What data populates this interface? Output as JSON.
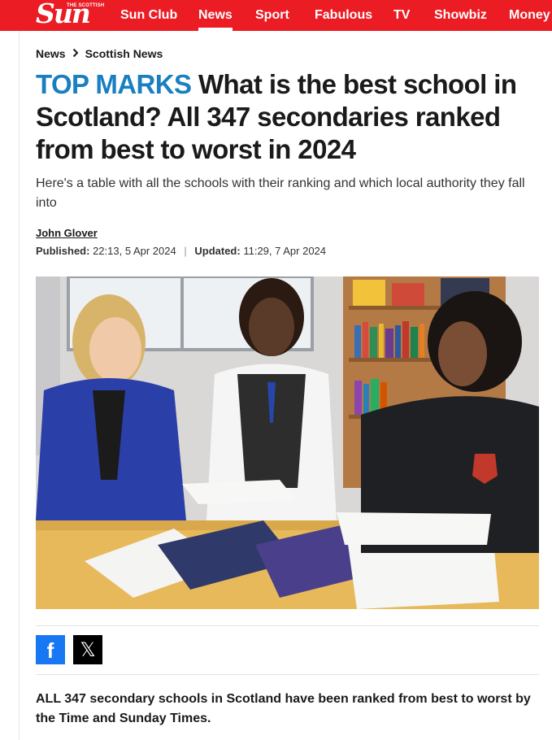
{
  "brand": {
    "logo_text": "Sun",
    "logo_tag": "THE SCOTTISH",
    "color_primary": "#eb1c24",
    "color_kicker": "#1a7fc1"
  },
  "nav": {
    "items": [
      {
        "label": "Sun Club"
      },
      {
        "label": "News",
        "active": true
      },
      {
        "label": "Sport"
      },
      {
        "label": "Fabulous"
      },
      {
        "label": "TV"
      },
      {
        "label": "Showbiz"
      },
      {
        "label": "Money"
      }
    ]
  },
  "breadcrumb": {
    "items": [
      "News",
      "Scottish News"
    ],
    "separator_icon": "chevron-right-icon"
  },
  "article": {
    "kicker": "TOP MARKS",
    "headline": "What is the best school in Scotland? All 347 secondaries ranked from best to worst in 2024",
    "standfirst": "Here's a table with all the schools with their ranking and which local authority they fall into",
    "author": "John Glover",
    "published_label": "Published:",
    "published_value": "22:13, 5 Apr 2024",
    "updated_label": "Updated:",
    "updated_value": "11:29, 7 Apr 2024",
    "hero_image": "three people around a school desk reading papers",
    "lede": "ALL 347 secondary schools in Scotland have been ranked from best to worst by the Time and Sunday Times."
  },
  "share": {
    "facebook_icon": "facebook-icon",
    "x_icon": "x-icon",
    "facebook_glyph": "f",
    "x_glyph": "𝕏"
  }
}
